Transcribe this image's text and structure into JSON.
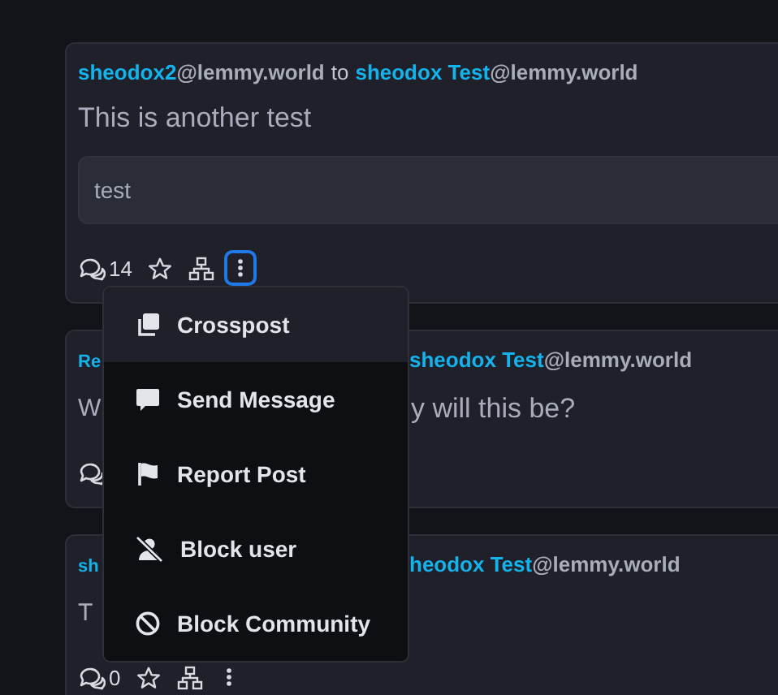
{
  "posts": [
    {
      "header": [
        {
          "text": "sheodox2",
          "kind": "name"
        },
        {
          "text": "@lemmy.world",
          "kind": "host"
        },
        {
          "text": "to",
          "kind": "plain"
        },
        {
          "text": "sheodox Test",
          "kind": "name"
        },
        {
          "text": "@lemmy.world",
          "kind": "host"
        }
      ],
      "title": "This is another test",
      "body": "test",
      "comments": "14",
      "actions": [
        {
          "kind": "star"
        },
        {
          "kind": "network"
        },
        {
          "kind": "more",
          "selected": true
        }
      ]
    },
    {
      "header": [
        {
          "text": "Re",
          "kind": "name"
        }
      ],
      "header_after_menu": [
        {
          "text": "sheodox Test",
          "kind": "name"
        },
        {
          "text": "@lemmy.world",
          "kind": "host"
        }
      ],
      "title": "W",
      "title_after_menu": "y will this be?"
    },
    {
      "header": [
        {
          "text": "sh",
          "kind": "name"
        }
      ],
      "header_after_menu": [
        {
          "text": "heodox Test",
          "kind": "name"
        },
        {
          "text": "@lemmy.world",
          "kind": "host"
        }
      ],
      "title": "T",
      "comments": "0",
      "actions": [
        {
          "kind": "star"
        },
        {
          "kind": "network"
        },
        {
          "kind": "more",
          "selected": false
        }
      ]
    }
  ],
  "menu": [
    {
      "label": "Crosspost",
      "kind": "crosspost",
      "selected": true
    },
    {
      "label": "Send Message",
      "kind": "message",
      "selected": false
    },
    {
      "label": "Report Post",
      "kind": "report",
      "selected": false
    },
    {
      "label": "Block user",
      "kind": "block-user",
      "selected": false
    },
    {
      "label": "Block Community",
      "kind": "block-community",
      "selected": false
    }
  ]
}
